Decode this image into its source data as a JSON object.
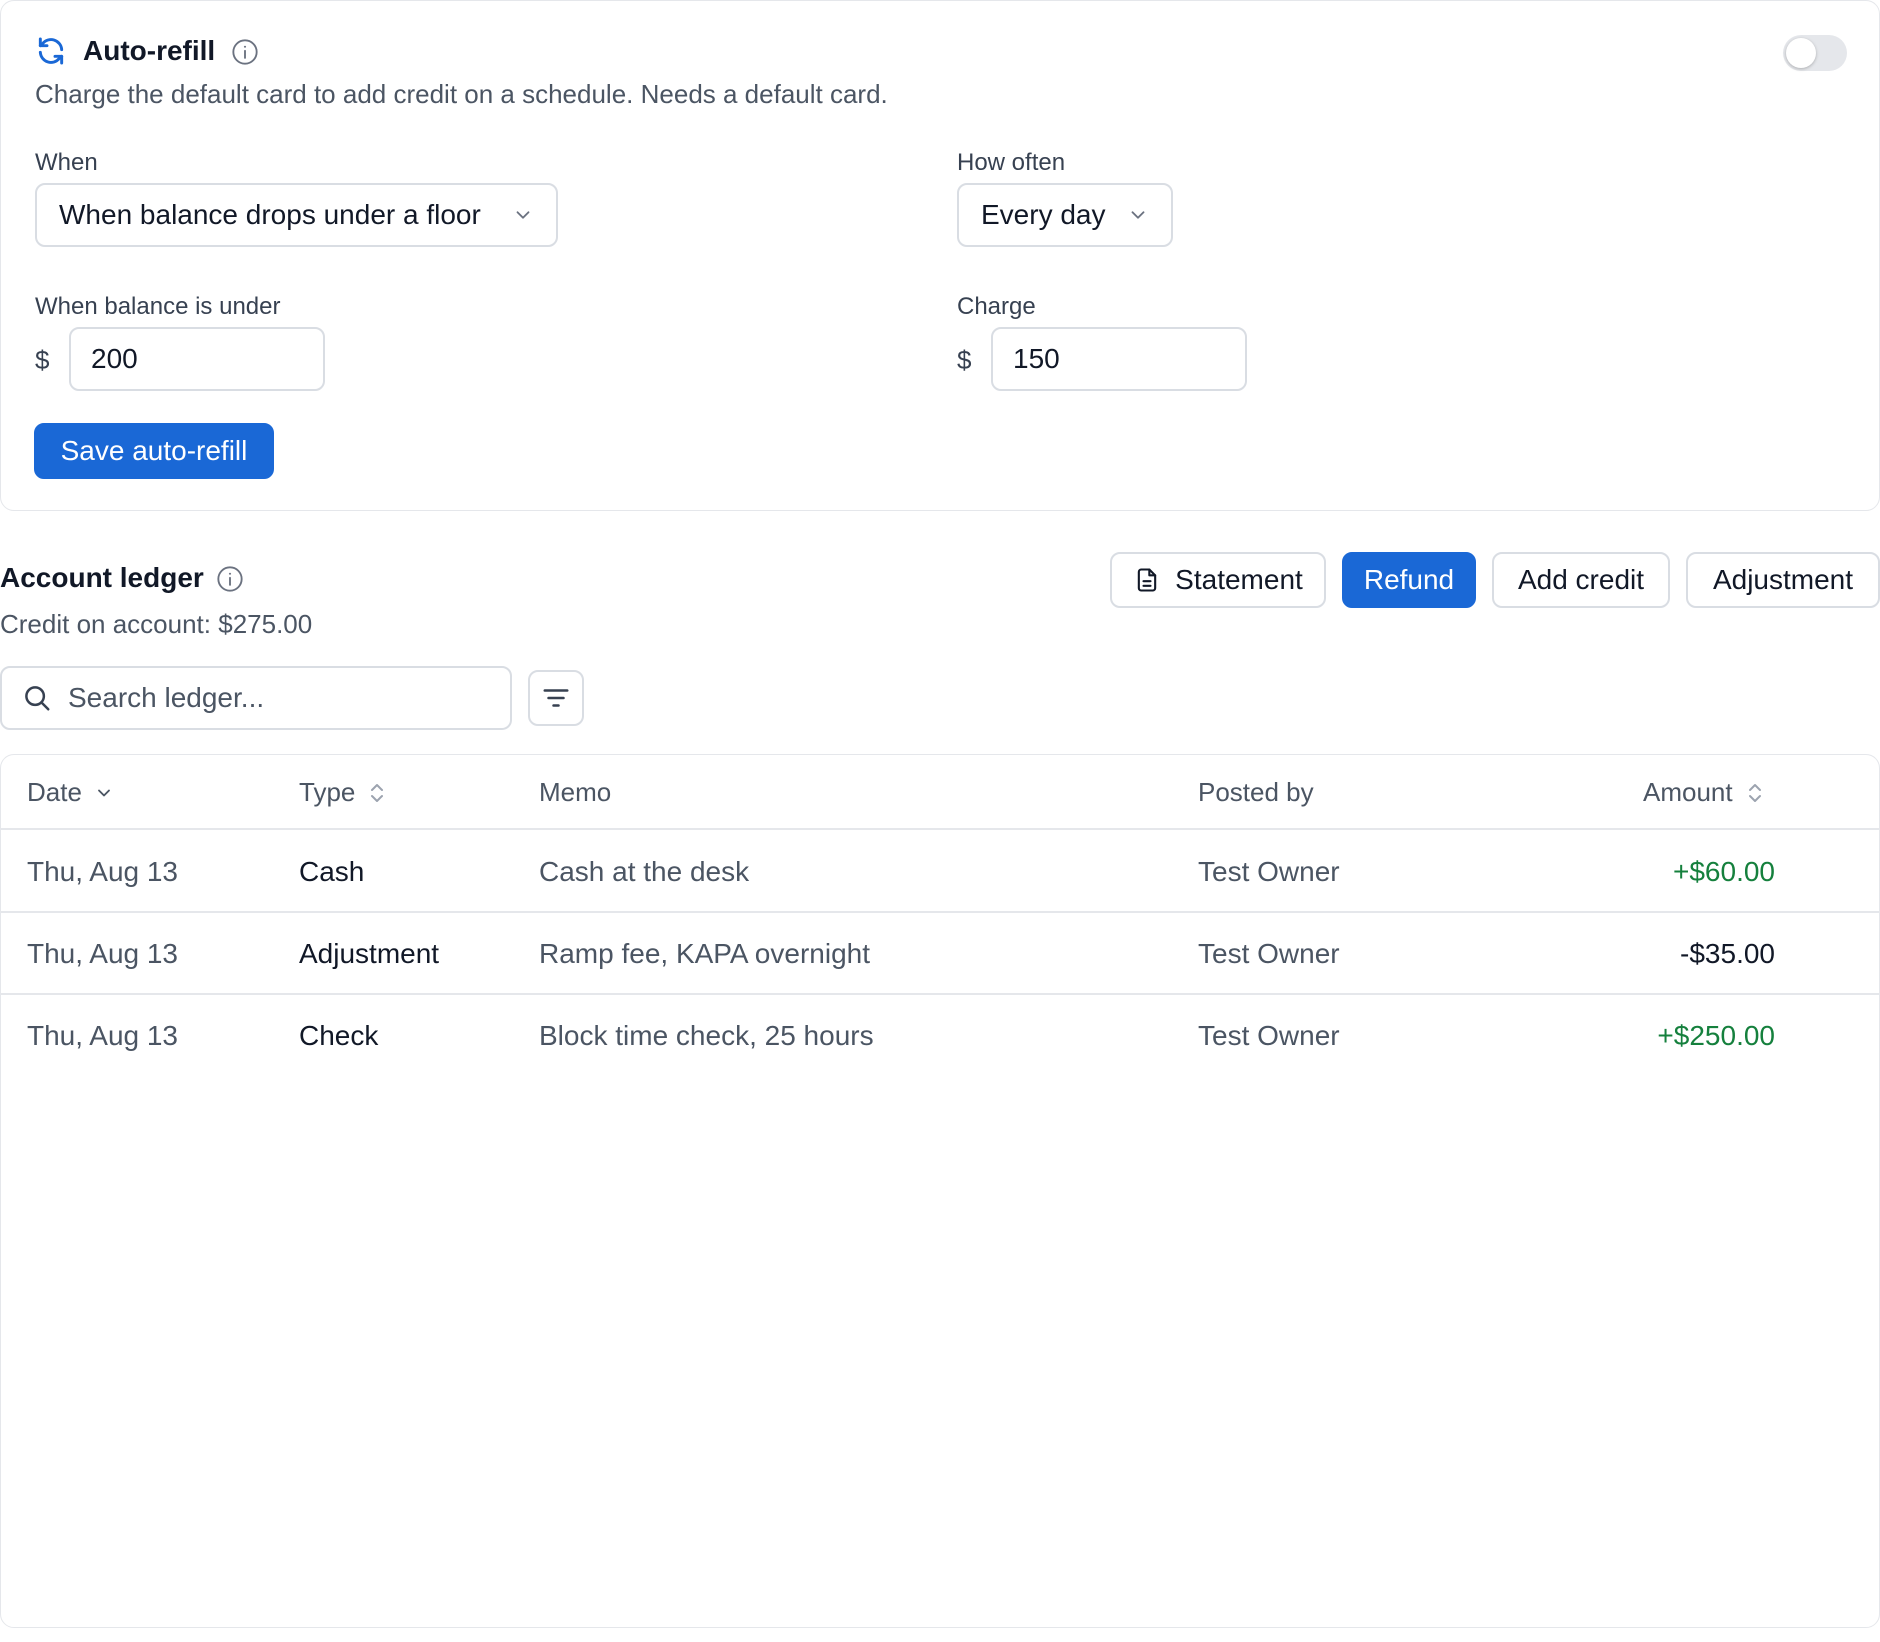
{
  "autorefill": {
    "title": "Auto-refill",
    "description": "Charge the default card to add credit on a schedule. Needs a default card.",
    "toggle_on": false,
    "when_label": "When",
    "when_value": "When balance drops under a floor",
    "how_often_label": "How often",
    "how_often_value": "Every day",
    "balance_label": "When balance is under",
    "balance_currency": "$",
    "balance_value": "200",
    "charge_label": "Charge",
    "charge_currency": "$",
    "charge_value": "150",
    "save_label": "Save auto-refill"
  },
  "ledger": {
    "title": "Account ledger",
    "credit": "Credit on account: $275.00",
    "buttons": {
      "statement": "Statement",
      "refund": "Refund",
      "add_credit": "Add credit",
      "adjustment": "Adjustment"
    },
    "search_placeholder": "Search ledger...",
    "columns": {
      "date": "Date",
      "type": "Type",
      "memo": "Memo",
      "posted_by": "Posted by",
      "amount": "Amount"
    },
    "rows": [
      {
        "date": "Thu, Aug 13",
        "type": "Cash",
        "memo": "Cash at the desk",
        "posted_by": "Test Owner",
        "amount": "+$60.00"
      },
      {
        "date": "Thu, Aug 13",
        "type": "Adjustment",
        "memo": "Ramp fee, KAPA overnight",
        "posted_by": "Test Owner",
        "amount": "-$35.00"
      },
      {
        "date": "Thu, Aug 13",
        "type": "Check",
        "memo": "Block time check, 25 hours",
        "posted_by": "Test Owner",
        "amount": "+$250.00"
      }
    ]
  },
  "colors": {
    "accent": "#1a68d6",
    "positive": "#15803d"
  }
}
